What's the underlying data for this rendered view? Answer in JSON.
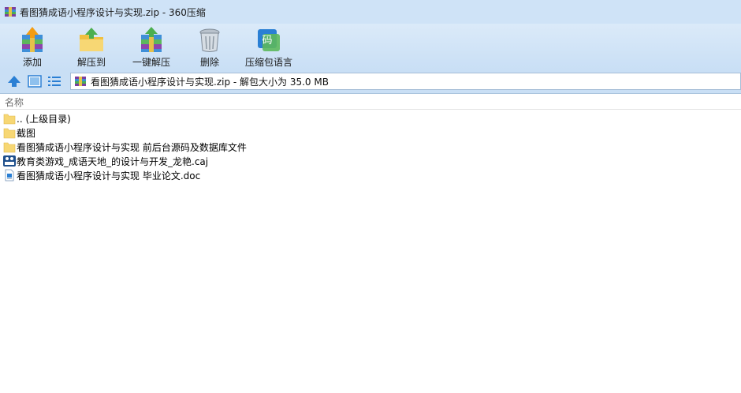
{
  "window": {
    "title": "看图猜成语小程序设计与实现.zip - 360压缩"
  },
  "toolbar": {
    "buttons": [
      {
        "label": "添加",
        "icon": "add-archive-icon"
      },
      {
        "label": "解压到",
        "icon": "extract-to-icon"
      },
      {
        "label": "一键解压",
        "icon": "one-click-extract-icon"
      },
      {
        "label": "删除",
        "icon": "trash-icon"
      },
      {
        "label": "压缩包语言",
        "icon": "encoding-icon",
        "icon_text": "码"
      }
    ]
  },
  "navbar": {
    "address": "看图猜成语小程序设计与实现.zip - 解包大小为 35.0 MB"
  },
  "list": {
    "column_name": "名称",
    "items": [
      {
        "name": ".. (上级目录)",
        "type": "folder"
      },
      {
        "name": "截图",
        "type": "folder"
      },
      {
        "name": "看图猜成语小程序设计与实现 前后台源码及数据库文件",
        "type": "folder"
      },
      {
        "name": "教育类游戏_成语天地_的设计与开发_龙艳.caj",
        "type": "caj"
      },
      {
        "name": "看图猜成语小程序设计与实现 毕业论文.doc",
        "type": "doc"
      }
    ]
  },
  "colors": {
    "titlebar": "#cfe3f7",
    "toolbar": "#c9dff5",
    "folder": "#f7d774",
    "accent_blue": "#2a7fd4"
  }
}
